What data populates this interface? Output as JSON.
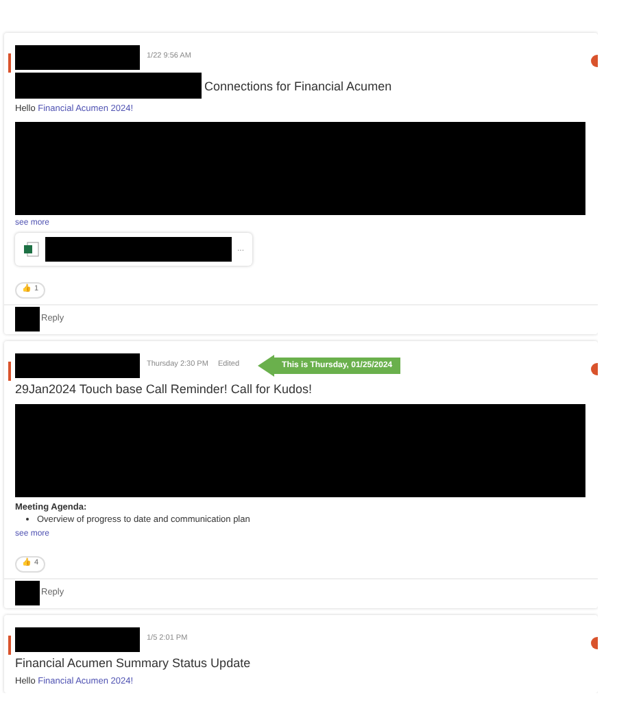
{
  "posts": [
    {
      "timestamp": "1/22 9:56 AM",
      "title": "Connections for Financial Acumen",
      "title_redacted": true,
      "body": [
        {
          "kind": "greeting",
          "text": "Hello ",
          "link": "Financial Acumen 2024!"
        },
        {
          "kind": "redacted"
        },
        {
          "kind": "see_more",
          "text": "see more"
        },
        {
          "kind": "attachment",
          "menu": "..."
        }
      ],
      "reaction": {
        "emoji": "👍",
        "count": "1"
      },
      "reply": "Reply"
    },
    {
      "timestamp": "Thursday 2:30 PM",
      "edited": "Edited",
      "callout": "This is Thursday, 01/25/2024",
      "title": "29Jan2024 Touch base Call Reminder! Call for Kudos!",
      "title_redacted": false,
      "body": [
        {
          "kind": "redacted"
        },
        {
          "kind": "agenda",
          "heading": "Meeting Agenda:",
          "items": [
            "Overview of progress to date and communication plan"
          ]
        },
        {
          "kind": "see_more",
          "text": "see more"
        }
      ],
      "reaction": {
        "emoji": "👍",
        "count": "4"
      },
      "reply": "Reply"
    },
    {
      "timestamp": "1/5 2:01 PM",
      "title": "Financial Acumen Summary Status Update",
      "title_redacted": false,
      "body": [
        {
          "kind": "greeting",
          "text": "Hello ",
          "link": "Financial Acumen 2024!"
        }
      ]
    }
  ]
}
